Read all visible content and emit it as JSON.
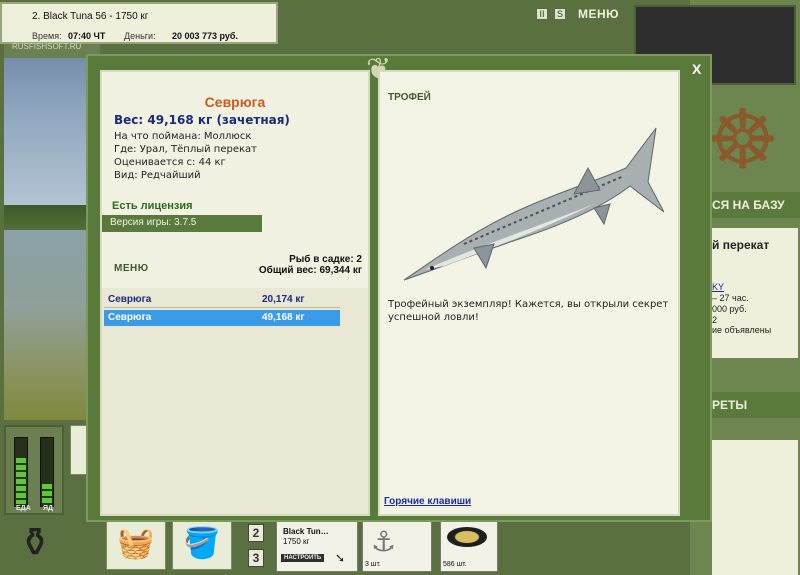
{
  "topbar": {
    "active_rod": "2. Black Tuna 56 - 1750 кг",
    "time_label": "Время:",
    "time_value": "07:40 ЧТ",
    "money_label": "Деньги:",
    "money_value": "20 003 773 руб.",
    "watermark": "RUSFISHSOFT.RU",
    "pause_icon": "II",
    "sound_icon": "S",
    "menu_label": "МЕНЮ"
  },
  "background": {
    "base_heading": "СЯ НА БАЗУ",
    "location_partial": "й перекат",
    "secrets_heading": "РЕТЫ",
    "lines": [
      "KY",
      "– 27 час.",
      "000 руб.",
      "2",
      "ие объявлены"
    ]
  },
  "status": {
    "eat_label": "ЕДА",
    "tired_label": "ЯД",
    "eat_level": 0.7,
    "tired_level": 0.3
  },
  "bottom": {
    "slot_numbers": [
      "2",
      "3"
    ],
    "rod_name": "Black Tun…",
    "rod_weight": "1750 кг",
    "rod_button": "НАСТРОИТЬ",
    "hook_qty": "3 шт.",
    "bait_qty": "586 шт."
  },
  "modal": {
    "close_label": "X",
    "fish": {
      "name": "Севрюга",
      "weight": "Вес: 49,168 кг (зачетная)",
      "caught_on": "На что поймана: Моллюск",
      "location": "Где: Урал, Тёплый перекат",
      "value": "Оценивается с: 44 кг",
      "rarity": "Вид: Редчайший"
    },
    "license": "Есть лицензия",
    "version": "Версия игры: 3.7.5",
    "menu_label": "МЕНЮ",
    "cage_count": "Рыб в садке: 2",
    "cage_weight": "Общий вес: 69,344 кг",
    "catches": [
      {
        "name": "Севрюга",
        "weight": "20,174 кг"
      },
      {
        "name": "Севрюга",
        "weight": "49,168 кг"
      }
    ],
    "trophy_title": "ТРОФЕЙ",
    "trophy_text": "Трофейный экземпляр! Кажется, вы открыли секрет успешной ловли!",
    "hotkeys_link": "Горячие клавиши"
  },
  "colors": {
    "frame_green": "#5a7a3c",
    "fish_name": "#cc5a1e",
    "weight_blue": "#1a2a7e",
    "selected_row": "#3a9be8",
    "license_green": "#2e6a1e"
  }
}
